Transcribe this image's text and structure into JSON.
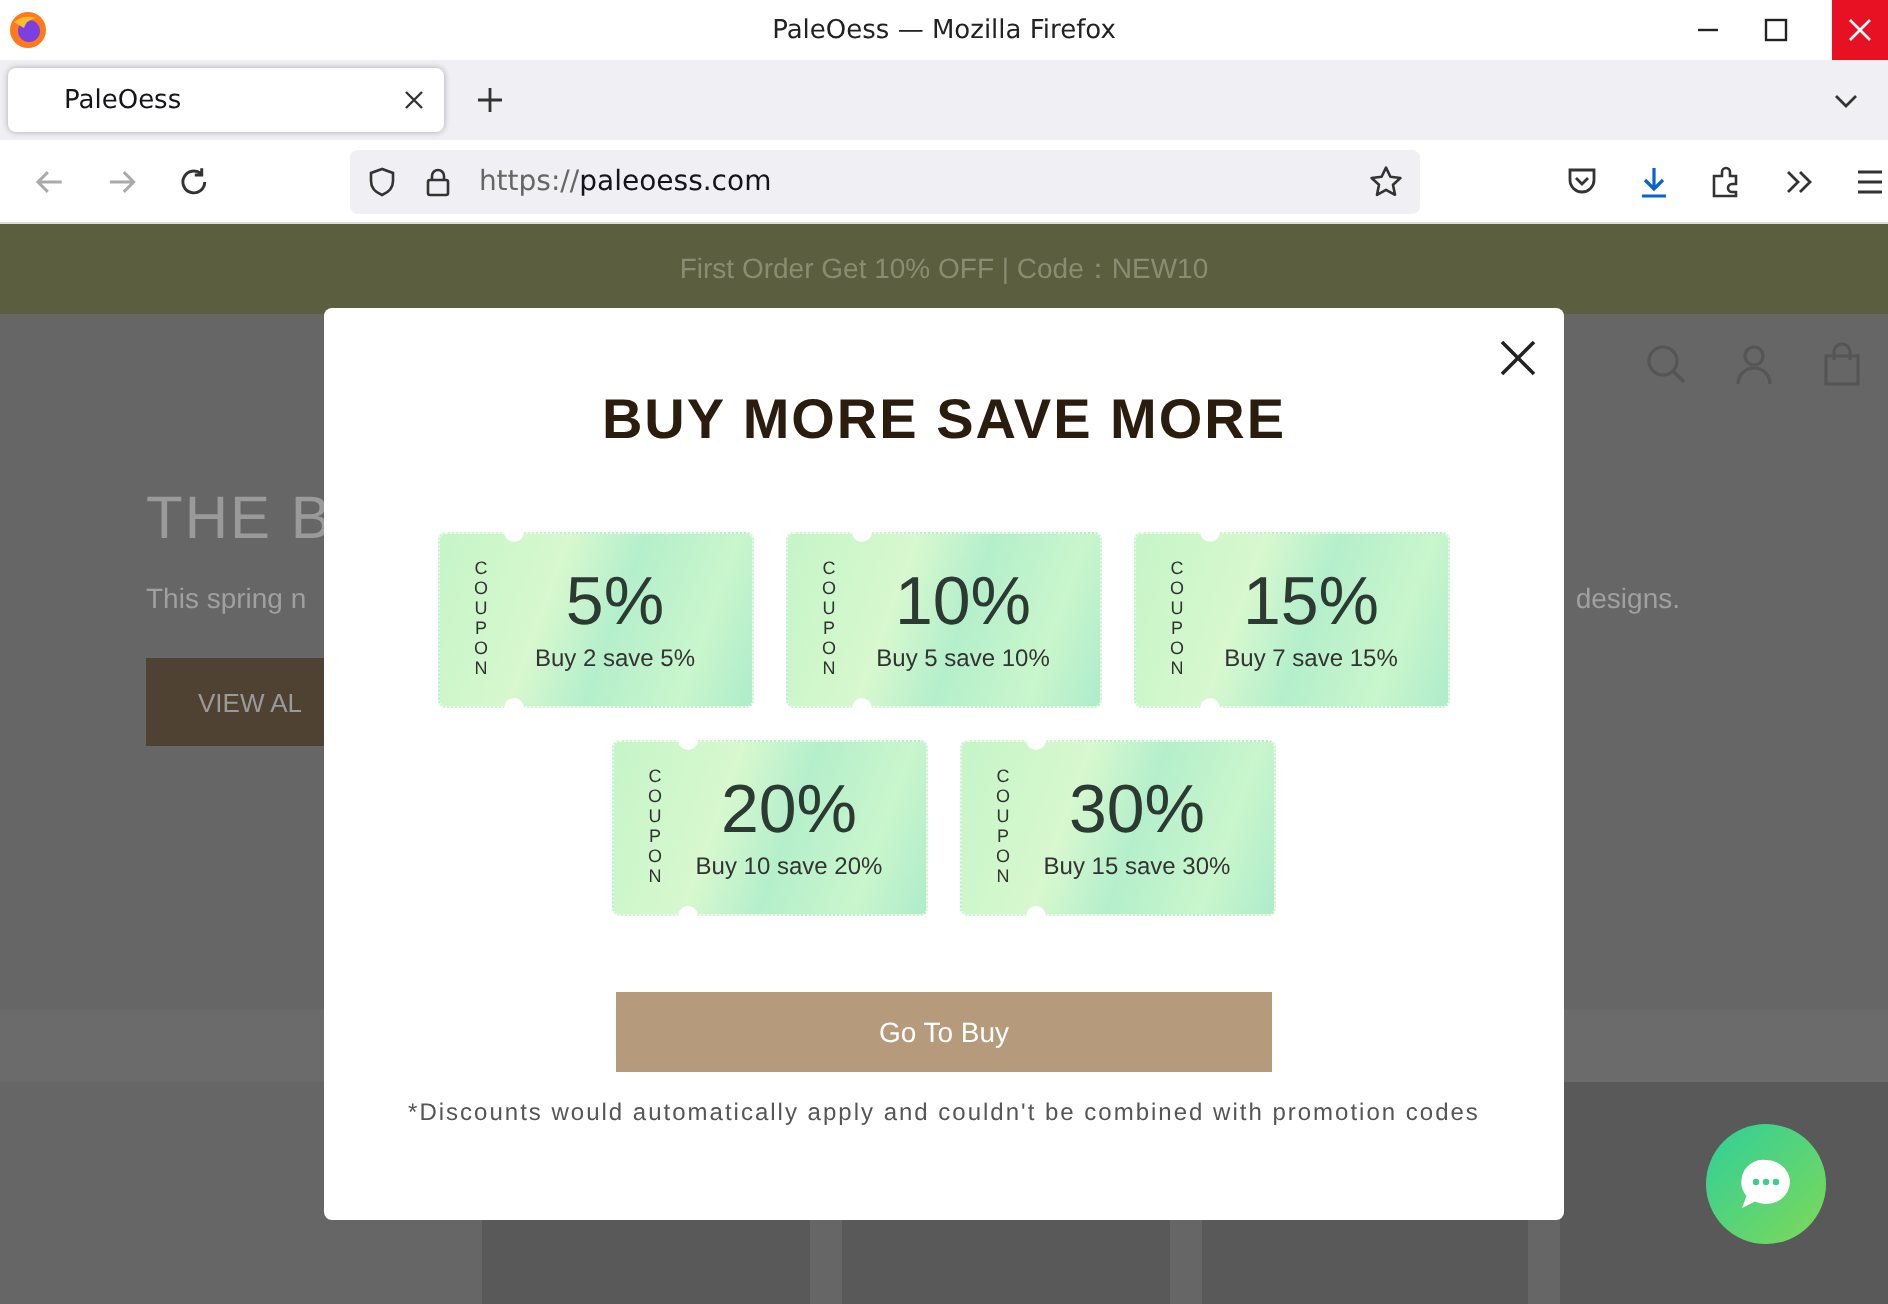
{
  "window": {
    "title": "PaleOess — Mozilla Firefox"
  },
  "tabs": [
    {
      "label": "PaleOess",
      "selected": true
    }
  ],
  "address_bar": {
    "scheme": "https://",
    "host": "paleoess.com"
  },
  "page": {
    "announcement": "First Order Get 10% OFF | Code：NEW10",
    "hero": {
      "heading": "THE B",
      "subtitle_left": "This spring n",
      "subtitle_right": "designs.",
      "button": "VIEW AL"
    }
  },
  "popup": {
    "title": "BUY MORE SAVE MORE",
    "coupons": [
      {
        "tag": "COUPON",
        "value": "5%",
        "text": "Buy 2 save 5%"
      },
      {
        "tag": "COUPON",
        "value": "10%",
        "text": "Buy 5 save 10%"
      },
      {
        "tag": "COUPON",
        "value": "15%",
        "text": "Buy 7 save 15%"
      },
      {
        "tag": "COUPON",
        "value": "20%",
        "text": "Buy 10 save 20%"
      },
      {
        "tag": "COUPON",
        "value": "30%",
        "text": "Buy 15 save 30%"
      }
    ],
    "button": "Go To Buy",
    "note": "*Discounts would automatically apply and couldn't be combined with promotion codes"
  }
}
